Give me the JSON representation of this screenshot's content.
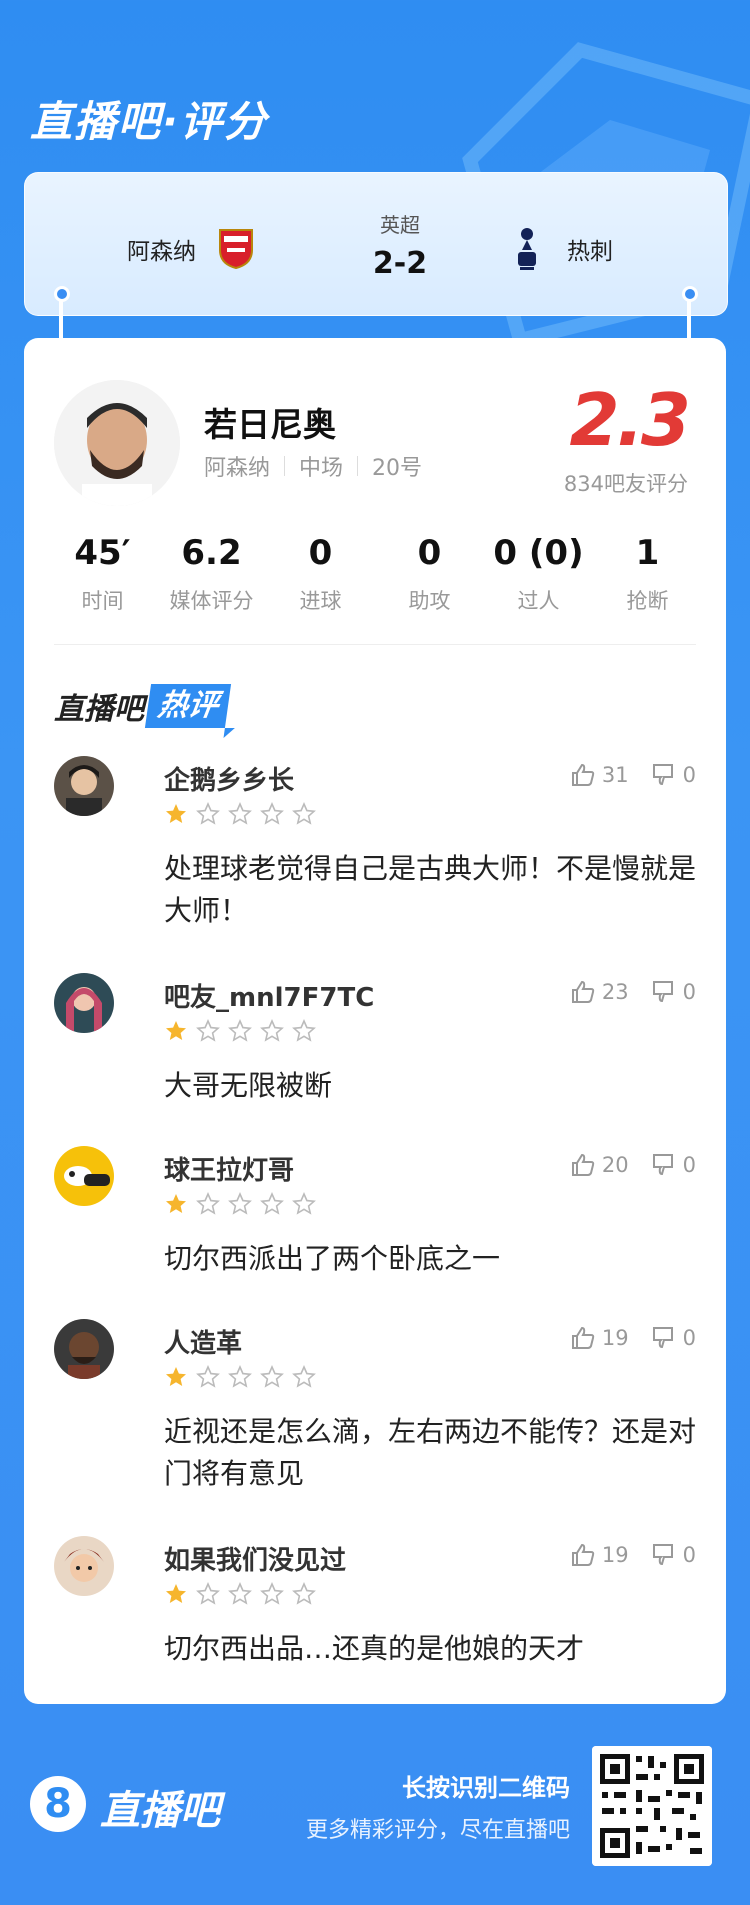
{
  "brand": {
    "title": "直播吧·评分"
  },
  "match": {
    "league": "英超",
    "score": "2-2",
    "home_team": "阿森纳",
    "away_team": "热刺"
  },
  "player": {
    "name": "若日尼奥",
    "team": "阿森纳",
    "position": "中场",
    "number": "20号",
    "rating": "2.3",
    "rating_count_label": "834吧友评分"
  },
  "stats": [
    {
      "value": "45′",
      "label": "时间"
    },
    {
      "value": "6.2",
      "label": "媒体评分"
    },
    {
      "value": "0",
      "label": "进球"
    },
    {
      "value": "0",
      "label": "助攻"
    },
    {
      "value": "0 (0)",
      "label": "过人"
    },
    {
      "value": "1",
      "label": "抢断"
    }
  ],
  "hot": {
    "prefix": "直播吧",
    "tag": "热评"
  },
  "comments": [
    {
      "user": "企鹅乡乡长",
      "stars": 1,
      "likes": "31",
      "dislikes": "0",
      "text": "处理球老觉得自己是古典大师！不是慢就是大师！"
    },
    {
      "user": "吧友_mnl7F7TC",
      "stars": 1,
      "likes": "23",
      "dislikes": "0",
      "text": "大哥无限被断"
    },
    {
      "user": "球王拉灯哥",
      "stars": 1,
      "likes": "20",
      "dislikes": "0",
      "text": "切尔西派出了两个卧底之一"
    },
    {
      "user": "人造革",
      "stars": 1,
      "likes": "19",
      "dislikes": "0",
      "text": "近视还是怎么滴，左右两边不能传？还是对门将有意见"
    },
    {
      "user": "如果我们没见过",
      "stars": 1,
      "likes": "19",
      "dislikes": "0",
      "text": "切尔西出品…还真的是他娘的天才"
    }
  ],
  "footer": {
    "logo_digit": "8",
    "logo_text": "直播吧",
    "scan_title": "长按识别二维码",
    "scan_sub": "更多精彩评分，尽在直播吧"
  },
  "icons": {
    "like": "thumbs-up-icon",
    "dislike": "thumbs-down-icon",
    "star": "star-icon"
  },
  "colors": {
    "accent": "#2f8df2",
    "rating": "#e23a36",
    "star": "#f6b52d"
  }
}
